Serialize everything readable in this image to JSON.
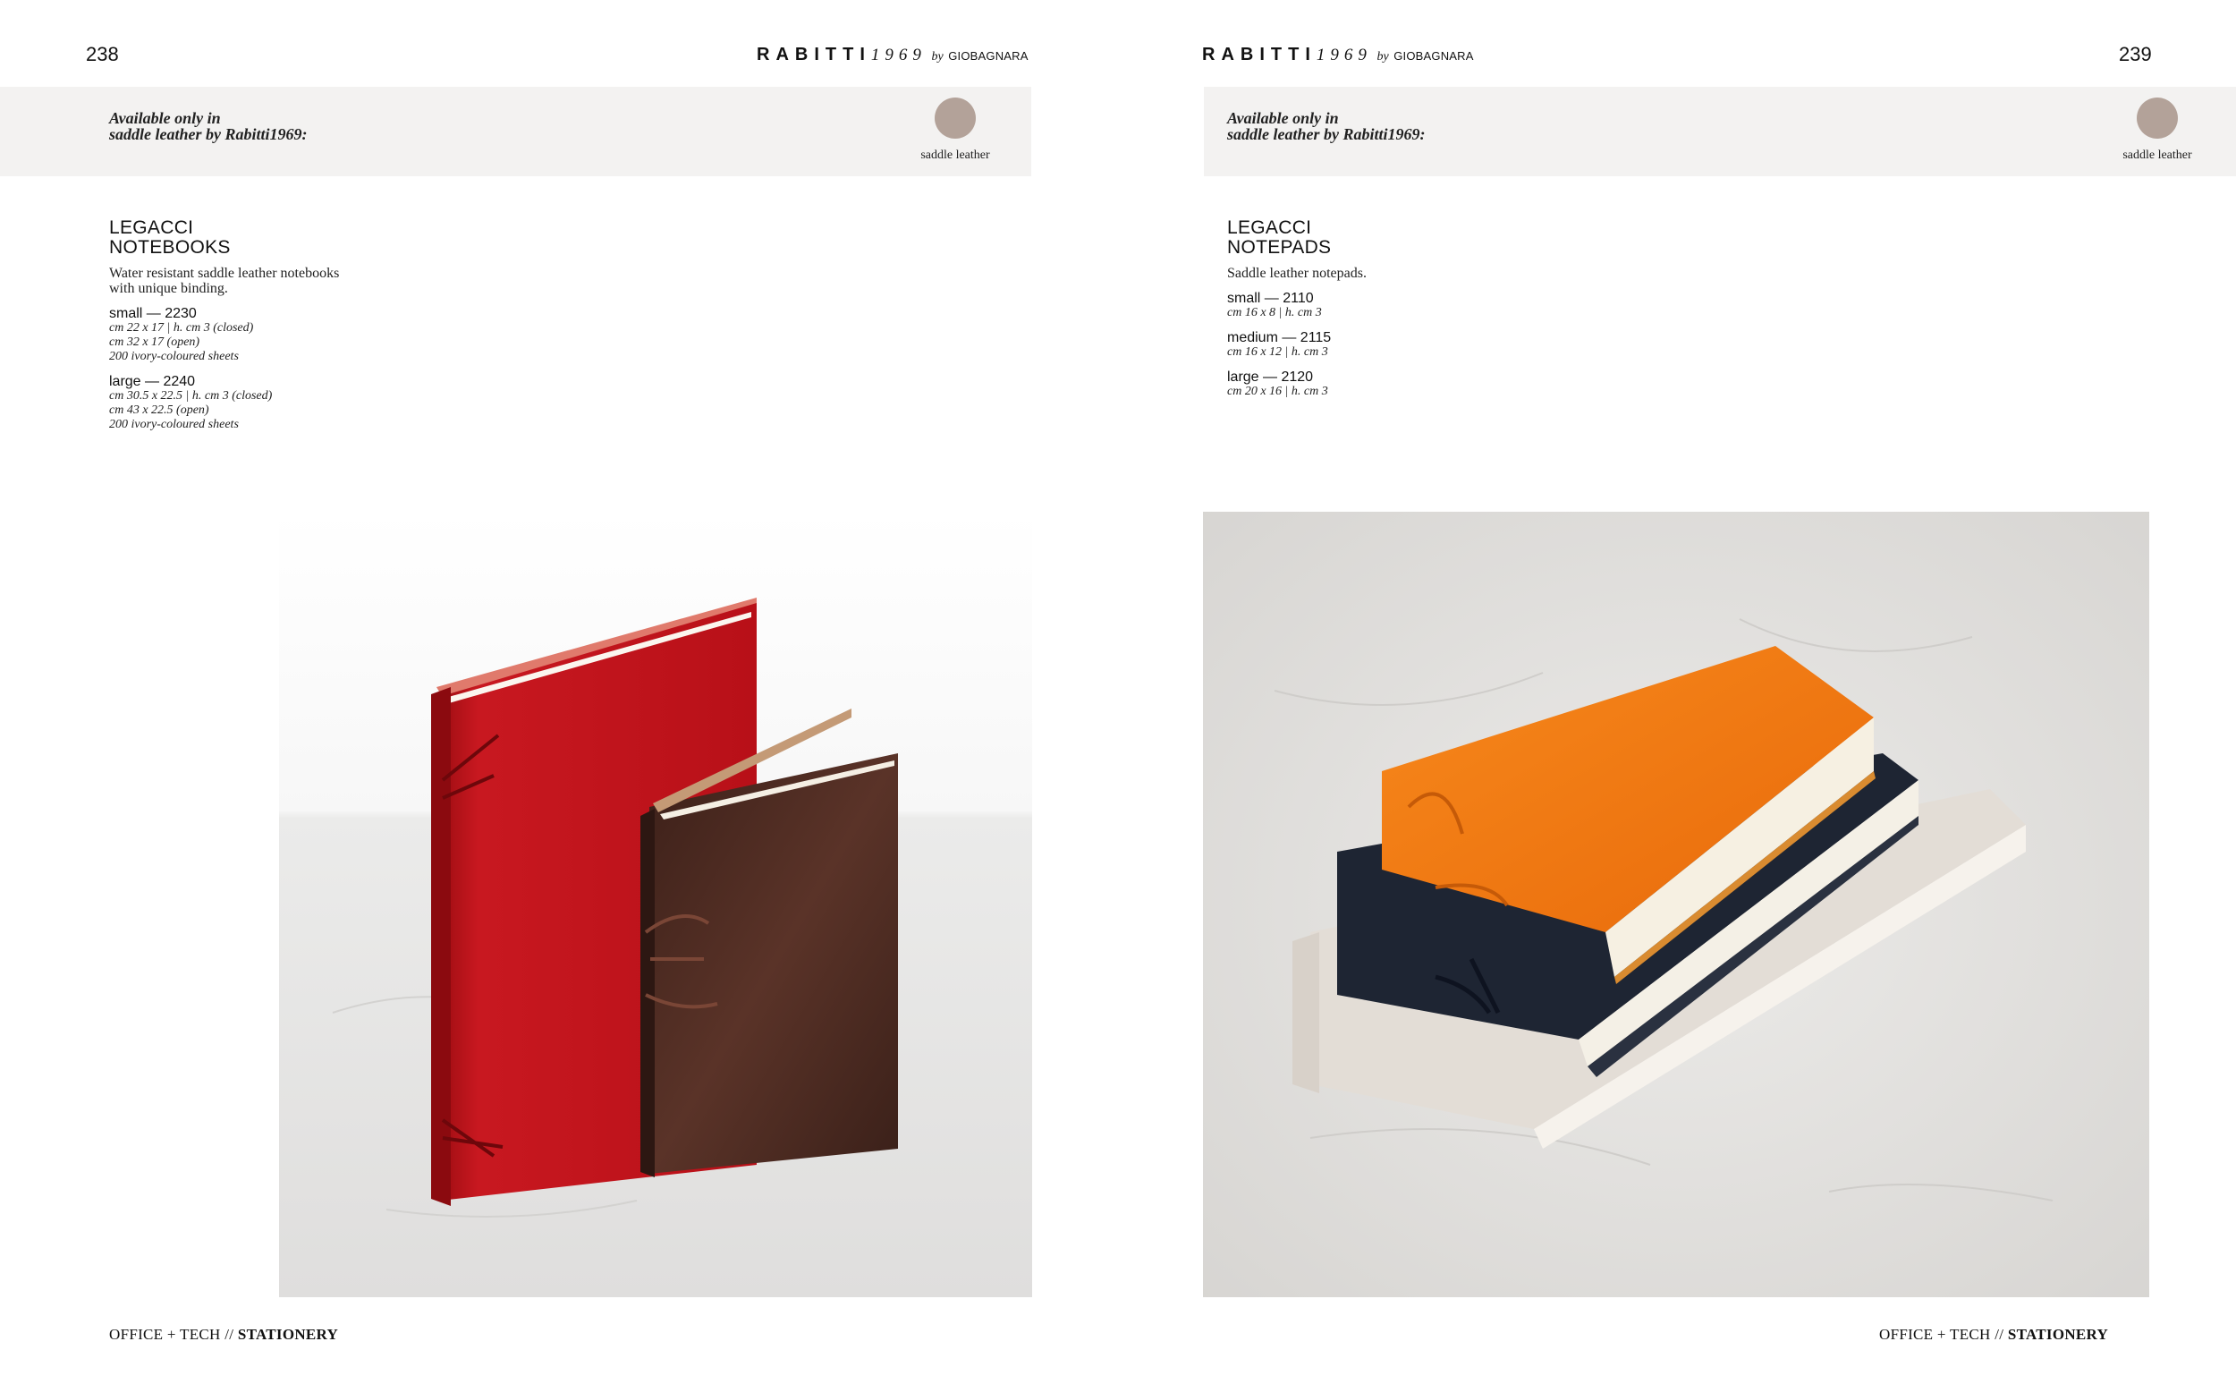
{
  "left": {
    "page_number": "238",
    "brand": {
      "name": "RABITTI",
      "year": "1969",
      "by": "by",
      "maker": "GIOBAGNARA"
    },
    "availability": "Available only in\nsaddle leather by Rabitti1969:",
    "swatch": {
      "label": "saddle leather",
      "color": "#b3a299"
    },
    "product": {
      "title_line1": "LEGACCI",
      "title_line2": "NOTEBOOKS",
      "description": "Water resistant saddle leather notebooks\nwith unique binding.",
      "variants": [
        {
          "name": "small — 2230",
          "specs": [
            "cm 22 x 17 | h. cm 3 (closed)",
            "cm 32 x 17 (open)",
            "200 ivory-coloured sheets"
          ]
        },
        {
          "name": "large — 2240",
          "specs": [
            "cm 30.5 x 22.5 | h. cm 3 (closed)",
            "cm 43 x 22.5 (open)",
            "200 ivory-coloured sheets"
          ]
        }
      ]
    },
    "photo": {
      "subject": "red-and-brown-leather-notebooks",
      "colors": [
        "#c4141c",
        "#4a2a22"
      ]
    },
    "footer": {
      "section": "OFFICE + TECH",
      "separator": "//",
      "category": "STATIONERY"
    }
  },
  "right": {
    "page_number": "239",
    "brand": {
      "name": "RABITTI",
      "year": "1969",
      "by": "by",
      "maker": "GIOBAGNARA"
    },
    "availability": "Available only in\nsaddle leather by Rabitti1969:",
    "swatch": {
      "label": "saddle leather",
      "color": "#b3a299"
    },
    "product": {
      "title_line1": "LEGACCI",
      "title_line2": "NOTEPADS",
      "description": "Saddle leather notepads.",
      "variants": [
        {
          "name": "small — 2110",
          "specs": [
            "cm 16 x 8 | h. cm 3"
          ]
        },
        {
          "name": "medium — 2115",
          "specs": [
            "cm 16 x 12 | h. cm 3"
          ]
        },
        {
          "name": "large — 2120",
          "specs": [
            "cm 20 x 16 | h. cm 3"
          ]
        }
      ]
    },
    "photo": {
      "subject": "stacked-leather-notepads",
      "colors": [
        "#f07a12",
        "#1e2533",
        "#ddd6ce"
      ]
    },
    "footer": {
      "section": "OFFICE + TECH",
      "separator": "//",
      "category": "STATIONERY"
    }
  }
}
